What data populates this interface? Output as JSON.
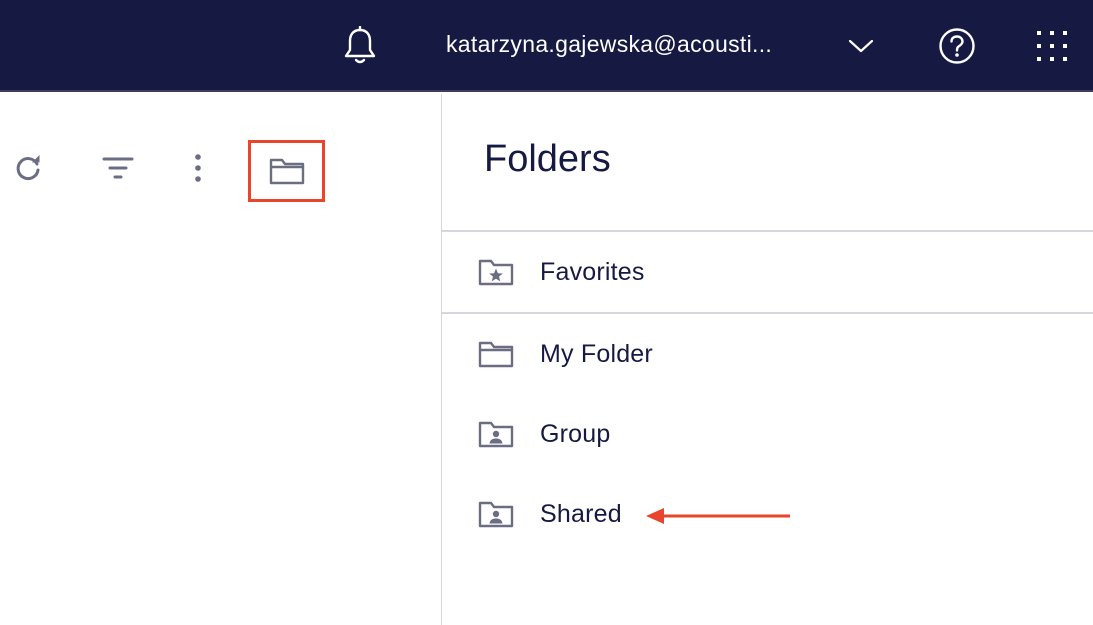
{
  "header": {
    "user_email": "katarzyna.gajewska@acousti...",
    "icons": {
      "notifications": "bell-icon",
      "account_menu": "chevron-down-icon",
      "help": "help-circle-icon",
      "apps": "grid-icon"
    }
  },
  "toolbar": {
    "icons": [
      "refresh-icon",
      "filter-icon",
      "more-vertical-icon",
      "folder-icon"
    ],
    "highlighted": "folder-icon"
  },
  "folders_panel": {
    "title": "Folders",
    "items": [
      {
        "label": "Favorites",
        "icon": "favorites-folder-icon"
      },
      {
        "label": "My Folder",
        "icon": "folder-icon"
      },
      {
        "label": "Group",
        "icon": "group-folder-icon"
      },
      {
        "label": "Shared",
        "icon": "shared-folder-icon"
      }
    ]
  },
  "colors": {
    "header_bg": "#161a43",
    "text_primary": "#161a43",
    "icon_gray": "#6b6e82",
    "highlight_red": "#e8452c",
    "divider": "#d6d7de"
  }
}
